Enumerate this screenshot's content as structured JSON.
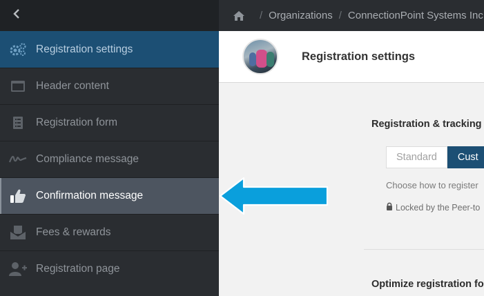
{
  "sidebar": {
    "back_icon": "chevron-left-icon",
    "items": [
      {
        "label": "Registration settings",
        "icon": "gears-icon"
      },
      {
        "label": "Header content",
        "icon": "browser-window-icon"
      },
      {
        "label": "Registration form",
        "icon": "checklist-icon"
      },
      {
        "label": "Compliance message",
        "icon": "signature-icon"
      },
      {
        "label": "Confirmation message",
        "icon": "thumbs-up-icon"
      },
      {
        "label": "Fees & rewards",
        "icon": "envelope-money-icon"
      },
      {
        "label": "Registration page",
        "icon": "user-plus-icon"
      }
    ]
  },
  "breadcrumb": {
    "items": [
      "Organizations",
      "ConnectionPoint Systems Inc"
    ]
  },
  "header": {
    "title": "Registration settings"
  },
  "content": {
    "section_title": "Registration & tracking",
    "toggle": {
      "standard": "Standard",
      "custom": "Cust"
    },
    "hint": "Choose how to register",
    "locked_text": "Locked by the Peer-to",
    "section2_title": "Optimize registration fo"
  },
  "colors": {
    "sidebar_bg": "#2a2d31",
    "active_bg": "#1c4f74",
    "selected_bg": "#4d5560",
    "arrow": "#0a9fdc"
  }
}
